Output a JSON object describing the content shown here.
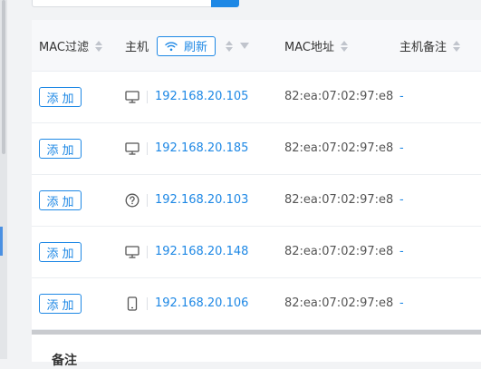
{
  "columns": {
    "mac_filter": "MAC过滤",
    "host": "主机",
    "refresh": "刷新",
    "mac_address": "MAC地址",
    "host_note": "主机备注"
  },
  "rows": [
    {
      "action": "添加",
      "device_icon": "monitor-icon",
      "ip": "192.168.20.105",
      "mac": "82:ea:07:02:97:e8",
      "note": "-"
    },
    {
      "action": "添加",
      "device_icon": "monitor-icon",
      "ip": "192.168.20.185",
      "mac": "82:ea:07:02:97:e8",
      "note": "-"
    },
    {
      "action": "添加",
      "device_icon": "unknown-device-icon",
      "ip": "192.168.20.103",
      "mac": "82:ea:07:02:97:e8",
      "note": "-"
    },
    {
      "action": "添加",
      "device_icon": "monitor-icon",
      "ip": "192.168.20.148",
      "mac": "82:ea:07:02:97:e8",
      "note": "-"
    },
    {
      "action": "添加",
      "device_icon": "phone-icon",
      "ip": "192.168.20.106",
      "mac": "82:ea:07:02:97:e8",
      "note": "-"
    }
  ],
  "bottom_panel": {
    "title": "备注"
  },
  "colors": {
    "accent": "#1e88e5",
    "header_bg": "#f7f8fa",
    "page_bg": "#f2f3f5"
  }
}
